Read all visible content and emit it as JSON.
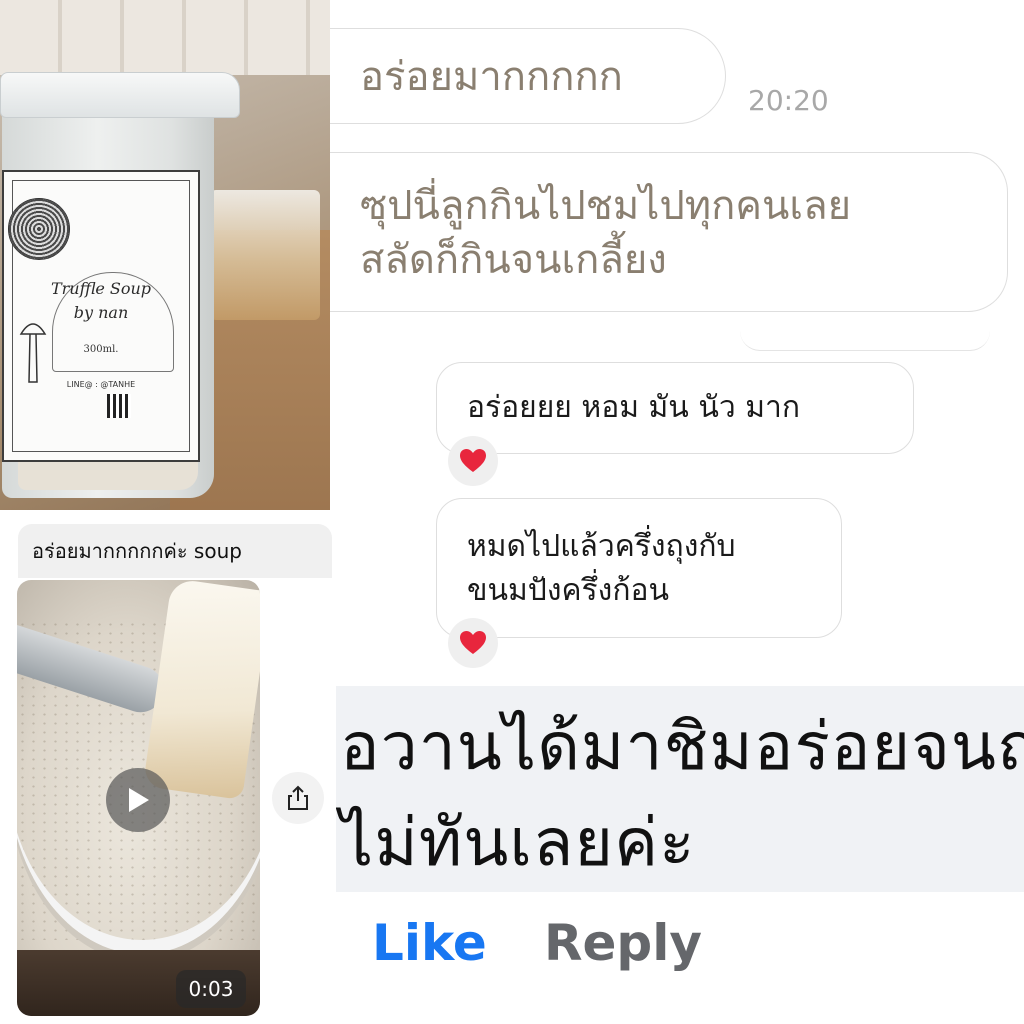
{
  "product_photo": {
    "label_title_line1": "Truffle Soup",
    "label_title_line2": "by nan",
    "label_size": "300ml.",
    "label_contact": "LINE@ : @TANHE"
  },
  "video_comment": {
    "caption": "อร่อยมากกกกกค่ะ soup",
    "duration": "0:03",
    "play_icon": "play-icon",
    "share_icon": "share-icon"
  },
  "chat": {
    "messages": [
      {
        "text": "อร่อยมากกกกก",
        "time": "20:20"
      },
      {
        "line1": "ซุปนี่ลูกกินไปชมไปทุกคนเลย",
        "line2": "สลัดก็กินจนเกลี้ยง"
      },
      {
        "text": "อร่อยยย หอม มัน นัว มาก",
        "reaction": "❤️"
      },
      {
        "line1": "หมดไปแล้วครึ่งถุงกับ",
        "line2": "ขนมปังครึ่งก้อน",
        "reaction": "❤️"
      }
    ]
  },
  "facebook_comment": {
    "line1": "อวานได้มาชิมอร่อยจนถ่",
    "line2": "ไม่ทันเลยค่ะ",
    "like_label": "Like",
    "reply_label": "Reply"
  },
  "colors": {
    "like_blue": "#1877f2",
    "reply_gray": "#65676b",
    "heart_red": "#e8263d"
  }
}
